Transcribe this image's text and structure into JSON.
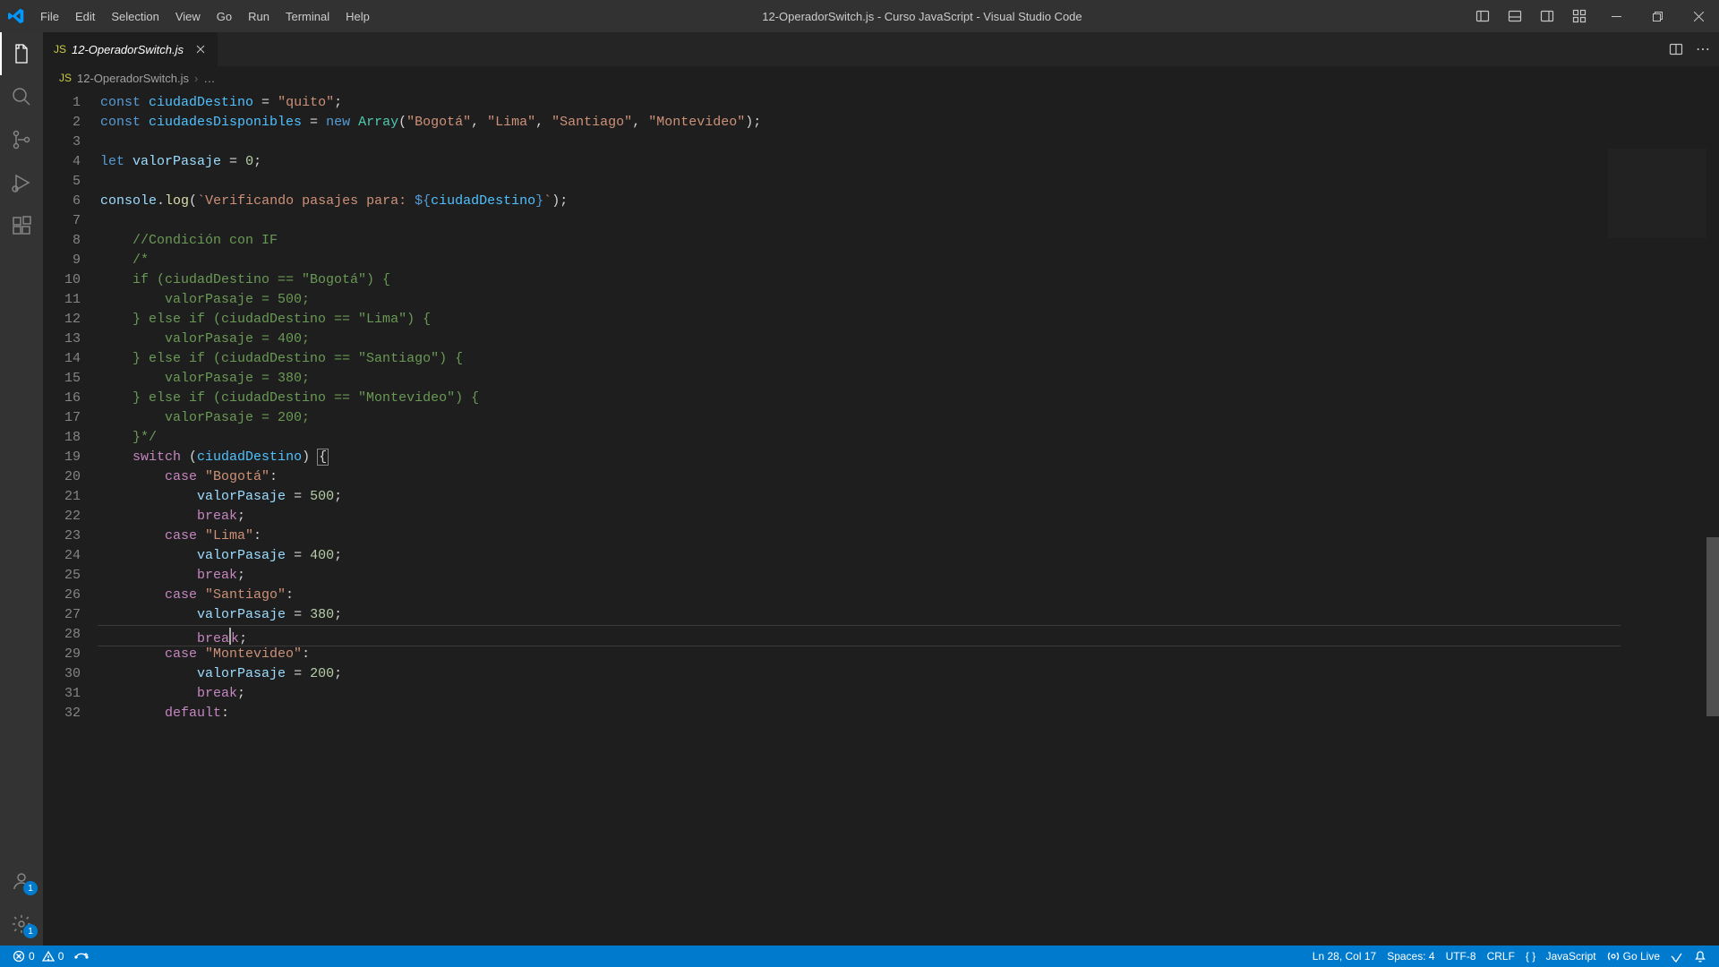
{
  "title": "12-OperadorSwitch.js - Curso JavaScript - Visual Studio Code",
  "menu": [
    "File",
    "Edit",
    "Selection",
    "View",
    "Go",
    "Run",
    "Terminal",
    "Help"
  ],
  "activity_badges": {
    "accounts": "1",
    "settings": "1"
  },
  "tab": {
    "label": "12-OperadorSwitch.js",
    "icon": "JS"
  },
  "breadcrumbs": {
    "file": "12-OperadorSwitch.js",
    "rest": "…"
  },
  "status": {
    "errors": "0",
    "warnings": "0",
    "cursor": "Ln 28, Col 17",
    "spaces": "Spaces: 4",
    "encoding": "UTF-8",
    "eol": "CRLF",
    "lang_icon": "{ }",
    "lang": "JavaScript",
    "golive": "Go Live"
  },
  "cursor_line": 28,
  "code": [
    {
      "n": 1,
      "i": 0,
      "seg": [
        [
          "kw",
          "const "
        ],
        [
          "const",
          "ciudadDestino"
        ],
        [
          "op",
          " = "
        ],
        [
          "str",
          "\"quito\""
        ],
        [
          "pun",
          ";"
        ]
      ]
    },
    {
      "n": 2,
      "i": 0,
      "seg": [
        [
          "kw",
          "const "
        ],
        [
          "const",
          "ciudadesDisponibles"
        ],
        [
          "op",
          " = "
        ],
        [
          "kw",
          "new "
        ],
        [
          "cls",
          "Array"
        ],
        [
          "pun",
          "("
        ],
        [
          "str",
          "\"Bogotá\""
        ],
        [
          "pun",
          ", "
        ],
        [
          "str",
          "\"Lima\""
        ],
        [
          "pun",
          ", "
        ],
        [
          "str",
          "\"Santiago\""
        ],
        [
          "pun",
          ", "
        ],
        [
          "str",
          "\"Montevideo\""
        ],
        [
          "pun",
          ");"
        ]
      ]
    },
    {
      "n": 3,
      "i": 0,
      "seg": []
    },
    {
      "n": 4,
      "i": 0,
      "seg": [
        [
          "kw",
          "let "
        ],
        [
          "var",
          "valorPasaje"
        ],
        [
          "op",
          " = "
        ],
        [
          "num",
          "0"
        ],
        [
          "pun",
          ";"
        ]
      ]
    },
    {
      "n": 5,
      "i": 0,
      "seg": []
    },
    {
      "n": 6,
      "i": 0,
      "seg": [
        [
          "var",
          "console"
        ],
        [
          "dot",
          "."
        ],
        [
          "fn",
          "log"
        ],
        [
          "pun",
          "("
        ],
        [
          "str",
          "`Verificando pasajes para: "
        ],
        [
          "kw",
          "${"
        ],
        [
          "const",
          "ciudadDestino"
        ],
        [
          "kw",
          "}"
        ],
        [
          "str",
          "`"
        ],
        [
          "pun",
          ");"
        ]
      ]
    },
    {
      "n": 7,
      "i": 0,
      "seg": []
    },
    {
      "n": 8,
      "i": 1,
      "seg": [
        [
          "cmt",
          "//Condición con IF"
        ]
      ]
    },
    {
      "n": 9,
      "i": 1,
      "seg": [
        [
          "cmt",
          "/*"
        ]
      ]
    },
    {
      "n": 10,
      "i": 1,
      "seg": [
        [
          "cmt",
          "if (ciudadDestino == \"Bogotá\") {"
        ]
      ]
    },
    {
      "n": 11,
      "i": 2,
      "seg": [
        [
          "cmt",
          "valorPasaje = 500;"
        ]
      ]
    },
    {
      "n": 12,
      "i": 1,
      "seg": [
        [
          "cmt",
          "} else if (ciudadDestino == \"Lima\") {"
        ]
      ]
    },
    {
      "n": 13,
      "i": 2,
      "seg": [
        [
          "cmt",
          "valorPasaje = 400;"
        ]
      ]
    },
    {
      "n": 14,
      "i": 1,
      "seg": [
        [
          "cmt",
          "} else if (ciudadDestino == \"Santiago\") {"
        ]
      ]
    },
    {
      "n": 15,
      "i": 2,
      "seg": [
        [
          "cmt",
          "valorPasaje = 380;"
        ]
      ]
    },
    {
      "n": 16,
      "i": 1,
      "seg": [
        [
          "cmt",
          "} else if (ciudadDestino == \"Montevideo\") {"
        ]
      ]
    },
    {
      "n": 17,
      "i": 2,
      "seg": [
        [
          "cmt",
          "valorPasaje = 200;"
        ]
      ]
    },
    {
      "n": 18,
      "i": 1,
      "seg": [
        [
          "cmt",
          "}*/"
        ]
      ]
    },
    {
      "n": 19,
      "i": 1,
      "seg": [
        [
          "ctrl",
          "switch"
        ],
        [
          "pun",
          " ("
        ],
        [
          "const",
          "ciudadDestino"
        ],
        [
          "pun",
          ") "
        ],
        [
          "brhl",
          "{"
        ]
      ]
    },
    {
      "n": 20,
      "i": 2,
      "seg": [
        [
          "ctrl",
          "case "
        ],
        [
          "str",
          "\"Bogotá\""
        ],
        [
          "pun",
          ":"
        ]
      ]
    },
    {
      "n": 21,
      "i": 3,
      "seg": [
        [
          "var",
          "valorPasaje"
        ],
        [
          "op",
          " = "
        ],
        [
          "num",
          "500"
        ],
        [
          "pun",
          ";"
        ]
      ]
    },
    {
      "n": 22,
      "i": 3,
      "seg": [
        [
          "ctrl",
          "break"
        ],
        [
          "pun",
          ";"
        ]
      ]
    },
    {
      "n": 23,
      "i": 2,
      "seg": [
        [
          "ctrl",
          "case "
        ],
        [
          "str",
          "\"Lima\""
        ],
        [
          "pun",
          ":"
        ]
      ]
    },
    {
      "n": 24,
      "i": 3,
      "seg": [
        [
          "var",
          "valorPasaje"
        ],
        [
          "op",
          " = "
        ],
        [
          "num",
          "400"
        ],
        [
          "pun",
          ";"
        ]
      ]
    },
    {
      "n": 25,
      "i": 3,
      "seg": [
        [
          "ctrl",
          "break"
        ],
        [
          "pun",
          ";"
        ]
      ]
    },
    {
      "n": 26,
      "i": 2,
      "seg": [
        [
          "ctrl",
          "case "
        ],
        [
          "str",
          "\"Santiago\""
        ],
        [
          "pun",
          ":"
        ]
      ]
    },
    {
      "n": 27,
      "i": 3,
      "seg": [
        [
          "var",
          "valorPasaje"
        ],
        [
          "op",
          " = "
        ],
        [
          "num",
          "380"
        ],
        [
          "pun",
          ";"
        ]
      ]
    },
    {
      "n": 28,
      "i": 3,
      "seg": [
        [
          "ctrl",
          "brea"
        ],
        [
          "cursor",
          ""
        ],
        [
          "ctrl",
          "k"
        ],
        [
          "pun",
          ";"
        ]
      ]
    },
    {
      "n": 29,
      "i": 2,
      "seg": [
        [
          "ctrl",
          "case "
        ],
        [
          "str",
          "\"Montevideo\""
        ],
        [
          "pun",
          ":"
        ]
      ]
    },
    {
      "n": 30,
      "i": 3,
      "seg": [
        [
          "var",
          "valorPasaje"
        ],
        [
          "op",
          " = "
        ],
        [
          "num",
          "200"
        ],
        [
          "pun",
          ";"
        ]
      ]
    },
    {
      "n": 31,
      "i": 3,
      "seg": [
        [
          "ctrl",
          "break"
        ],
        [
          "pun",
          ";"
        ]
      ]
    },
    {
      "n": 32,
      "i": 2,
      "seg": [
        [
          "ctrl",
          "default"
        ],
        [
          "pun",
          ":"
        ]
      ]
    }
  ]
}
